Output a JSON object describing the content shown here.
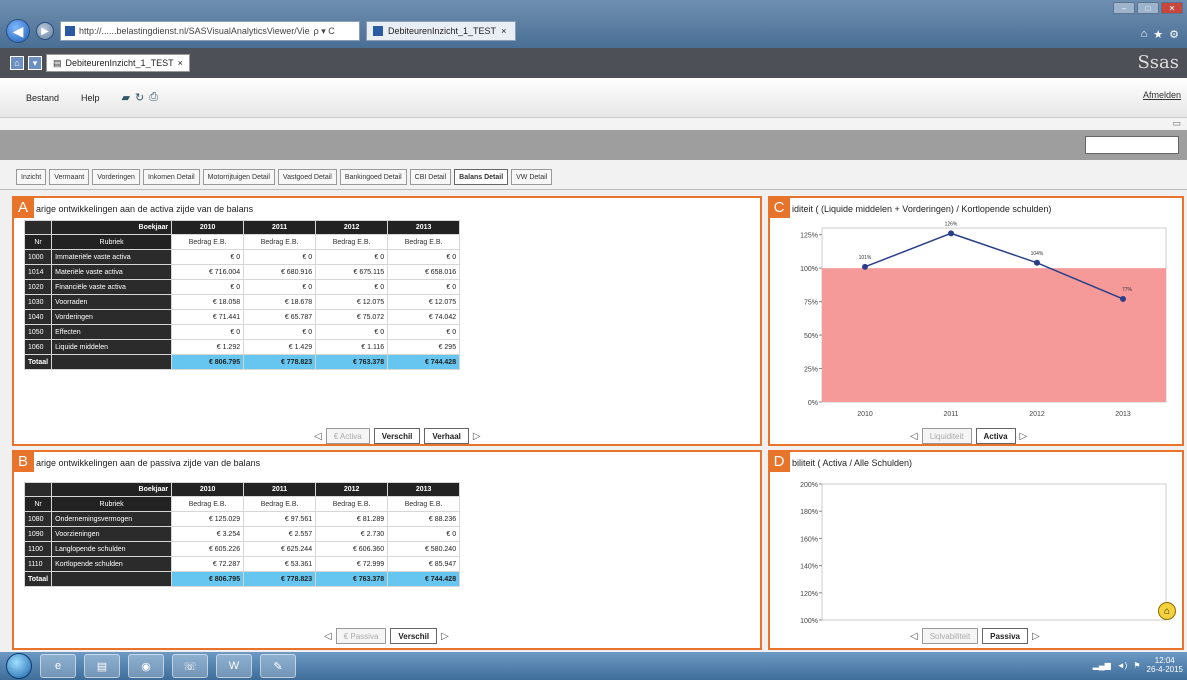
{
  "browser": {
    "url": "http://......belastingdienst.nl/SASVisualAnalyticsViewer/Vie",
    "search_hint": "ρ ▾ C",
    "tab_title": "DebiteurenInzicht_1_TEST",
    "tab_close": "×"
  },
  "app": {
    "tab_title": "DebiteurenInzicht_1_TEST",
    "tab_close": "×",
    "logo": "Ssas",
    "menu": {
      "file": "Bestand",
      "help": "Help"
    },
    "logout": "Afmelden"
  },
  "report_tabs": [
    "Inzicht",
    "Vermaant",
    "Vorderingen",
    "Inkomen Detail",
    "Motorrijtuigen Detail",
    "Vastgoed Detail",
    "Bankingoed Detail",
    "CBI Detail",
    "Balans Detail",
    "VW Detail"
  ],
  "active_tab_index": 8,
  "panel_a": {
    "badge": "A",
    "title": "arige ontwikkelingen aan de activa zijde van de balans",
    "header_label": "Boekjaar",
    "years": [
      "2010",
      "2011",
      "2012",
      "2013"
    ],
    "col_nr": "Nr",
    "col_rubriek": "Rubriek",
    "col_amount": "Bedrag E.B.",
    "rows": [
      {
        "nr": "1000",
        "name": "Immateriële vaste activa",
        "v": [
          "€ 0",
          "€ 0",
          "€ 0",
          "€ 0"
        ]
      },
      {
        "nr": "1014",
        "name": "Materiële vaste activa",
        "v": [
          "€ 716.004",
          "€ 680.916",
          "€ 675.115",
          "€ 658.016"
        ]
      },
      {
        "nr": "1020",
        "name": "Financiële vaste activa",
        "v": [
          "€ 0",
          "€ 0",
          "€ 0",
          "€ 0"
        ]
      },
      {
        "nr": "1030",
        "name": "Voorraden",
        "v": [
          "€ 18.058",
          "€ 18.678",
          "€ 12.075",
          "€ 12.075"
        ]
      },
      {
        "nr": "1040",
        "name": "Vorderingen",
        "v": [
          "€ 71.441",
          "€ 65.787",
          "€ 75.072",
          "€ 74.042"
        ]
      },
      {
        "nr": "1050",
        "name": "Effecten",
        "v": [
          "€ 0",
          "€ 0",
          "€ 0",
          "€ 0"
        ]
      },
      {
        "nr": "1060",
        "name": "Liquide middelen",
        "v": [
          "€ 1.292",
          "€ 1.429",
          "€ 1.116",
          "€ 295"
        ]
      }
    ],
    "total": {
      "label": "Totaal",
      "v": [
        "€ 806.795",
        "€ 778.823",
        "€ 763.378",
        "€ 744.428"
      ]
    },
    "pager": [
      "€ Activa",
      "Verschil",
      "Verhaal"
    ],
    "pager_active": [
      false,
      true,
      true
    ]
  },
  "panel_b": {
    "badge": "B",
    "title": "arige ontwikkelingen aan de passiva zijde van de balans",
    "header_label": "Boekjaar",
    "years": [
      "2010",
      "2011",
      "2012",
      "2013"
    ],
    "col_nr": "Nr",
    "col_rubriek": "Rubriek",
    "col_amount": "Bedrag E.B.",
    "rows": [
      {
        "nr": "1080",
        "name": "Ondernemingsvermogen",
        "v": [
          "€ 125.029",
          "€ 97.561",
          "€ 81.289",
          "€ 88.236"
        ]
      },
      {
        "nr": "1090",
        "name": "Voorzieningen",
        "v": [
          "€ 3.254",
          "€ 2.557",
          "€ 2.730",
          "€ 0"
        ]
      },
      {
        "nr": "1100",
        "name": "Langlopende schulden",
        "v": [
          "€ 605.226",
          "€ 625.244",
          "€ 606.360",
          "€ 580.240"
        ]
      },
      {
        "nr": "1110",
        "name": "Kortlopende schulden",
        "v": [
          "€ 72.287",
          "€ 53.361",
          "€ 72.999",
          "€ 85.947"
        ]
      }
    ],
    "total": {
      "label": "Totaal",
      "v": [
        "€ 806.795",
        "€ 778.823",
        "€ 763.378",
        "€ 744.428"
      ]
    },
    "pager": [
      "€ Passiva",
      "Verschil"
    ],
    "pager_active": [
      false,
      true
    ]
  },
  "panel_c": {
    "badge": "C",
    "title": "iditeit ( (Liquide middelen + Vorderingen) / Kortlopende schulden)",
    "pager": [
      "Liquiditeit",
      "Activa"
    ],
    "pager_active": [
      false,
      true
    ]
  },
  "panel_d": {
    "badge": "D",
    "title": "biliteit ( Activa / Alle Schulden)",
    "pager": [
      "Solvabiliteit",
      "Passiva"
    ],
    "pager_active": [
      false,
      true
    ]
  },
  "chart_data": [
    {
      "type": "line",
      "title": "",
      "x": [
        "2010",
        "2011",
        "2012",
        "2013"
      ],
      "series": [
        {
          "values": [
            101,
            126,
            104,
            77
          ],
          "labels": [
            "101%",
            "126%",
            "104%",
            "77%"
          ]
        }
      ],
      "ylim": [
        0,
        130
      ],
      "yticks": [
        "0%",
        "25%",
        "50%",
        "75%",
        "100%",
        "125%"
      ],
      "threshold_band_below": 100,
      "band_color": "#f59a98",
      "line_color": "#2a3f8a",
      "grid": false
    },
    {
      "type": "line",
      "title": "",
      "x": [],
      "series": [],
      "ylim": [
        100,
        200
      ],
      "yticks": [
        "100%",
        "120%",
        "140%",
        "160%",
        "180%",
        "200%"
      ],
      "grid": false
    }
  ],
  "taskbar": {
    "clock_time": "12:04",
    "clock_date": "26-4-2015"
  }
}
